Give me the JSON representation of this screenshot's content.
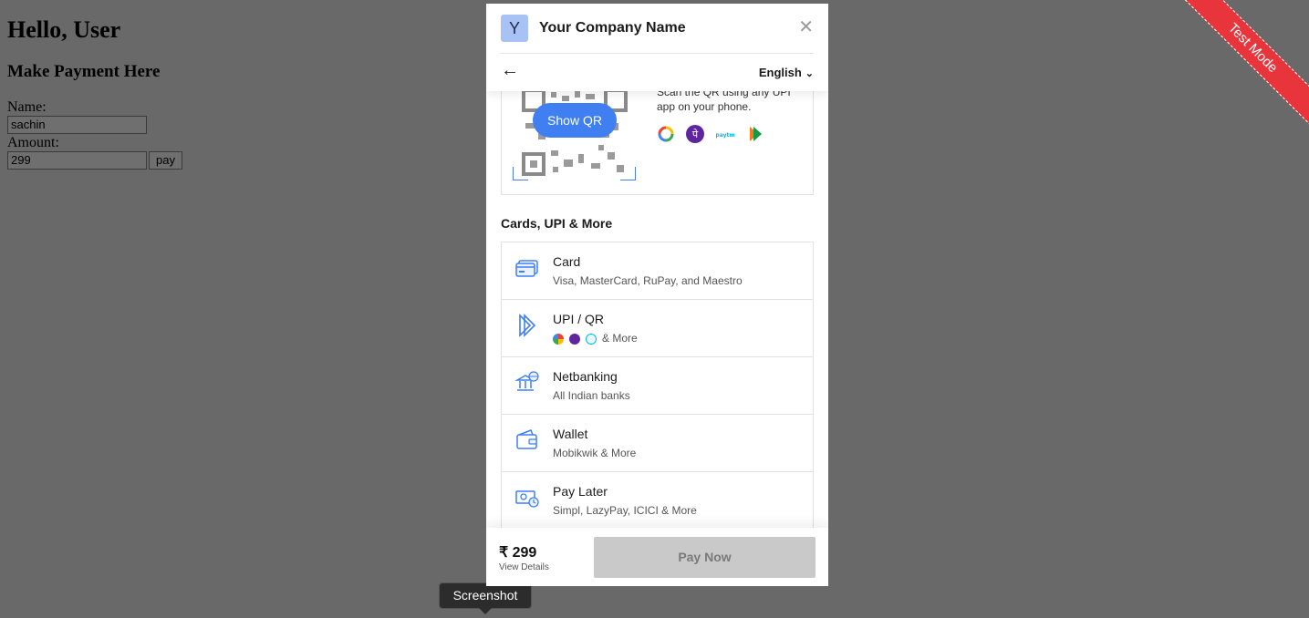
{
  "merchant_page": {
    "greeting": "Hello, User",
    "subtitle": "Make Payment Here",
    "name_label": "Name:",
    "name_value": "sachin",
    "amount_label": "Amount:",
    "amount_value": "299",
    "pay_label": "pay"
  },
  "ribbon": {
    "text": "Test Mode"
  },
  "checkout": {
    "logo_letter": "Y",
    "company_name": "Your Company Name",
    "close_icon": "close-icon",
    "back_icon": "arrow-left-icon",
    "language": "English",
    "qr": {
      "show_qr_label": "Show QR",
      "instruction": "Scan the QR using any UPI app on your phone."
    },
    "section_title": "Cards, UPI & More",
    "methods": [
      {
        "title": "Card",
        "subtitle": "Visa, MasterCard, RuPay, and Maestro",
        "icon": "card-icon"
      },
      {
        "title": "UPI / QR",
        "subtitle": "& More",
        "icon": "upi-icon"
      },
      {
        "title": "Netbanking",
        "subtitle": "All Indian banks",
        "icon": "bank-icon"
      },
      {
        "title": "Wallet",
        "subtitle": "Mobikwik & More",
        "icon": "wallet-icon"
      },
      {
        "title": "Pay Later",
        "subtitle": "Simpl, LazyPay, ICICI & More",
        "icon": "pay-later-icon"
      }
    ],
    "footer": {
      "amount": "₹ 299",
      "view_details": "View Details",
      "pay_now": "Pay Now"
    }
  },
  "tooltip": {
    "text": "Screenshot"
  },
  "colors": {
    "accent": "#3f7ff2",
    "ribbon": "#e8353b",
    "overlay": "#696969"
  }
}
